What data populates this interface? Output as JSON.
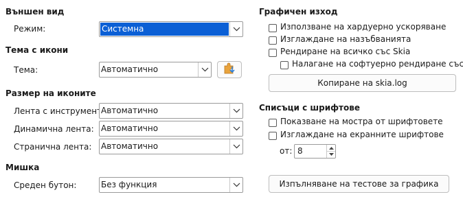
{
  "appearance": {
    "header": "Външен вид",
    "mode_label": "Режим:",
    "mode_value": "Системна"
  },
  "icon_theme": {
    "header": "Тема с икони",
    "theme_label": "Тема:",
    "theme_value": "Автоматично"
  },
  "icon_size": {
    "header": "Размер на иконите",
    "toolbar_label": "Лента с инструменти:",
    "toolbar_value": "Автоматично",
    "notebookbar_label": "Динамична лента:",
    "notebookbar_value": "Автоматично",
    "sidebar_label": "Странична лента:",
    "sidebar_value": "Автоматично"
  },
  "mouse": {
    "header": "Мишка",
    "middle_label": "Среден бутон:",
    "middle_value": "Без функция"
  },
  "graphics_output": {
    "header": "Графичен изход",
    "hw_accel": "Използване на хардуерно ускоряване",
    "antialias": "Изглаждане на назъбванията",
    "skia": "Рендиране на всичко със Skia",
    "skia_sw": "Налагане на софтуерно рендиране със Skia",
    "copy_log": "Копиране на skia.log"
  },
  "font_lists": {
    "header": "Списъци с шрифтове",
    "preview": "Показване на мостра от шрифтовете",
    "screen_aa": "Изглаждане на екранните шрифтове",
    "from_label": "от:",
    "from_value": "8"
  },
  "run_tests": "Изпълняване на тестове за графика",
  "colors": {
    "selection": "#0b5fd5",
    "icon_orange": "#e8a33d",
    "icon_blue": "#2f7fd6"
  }
}
